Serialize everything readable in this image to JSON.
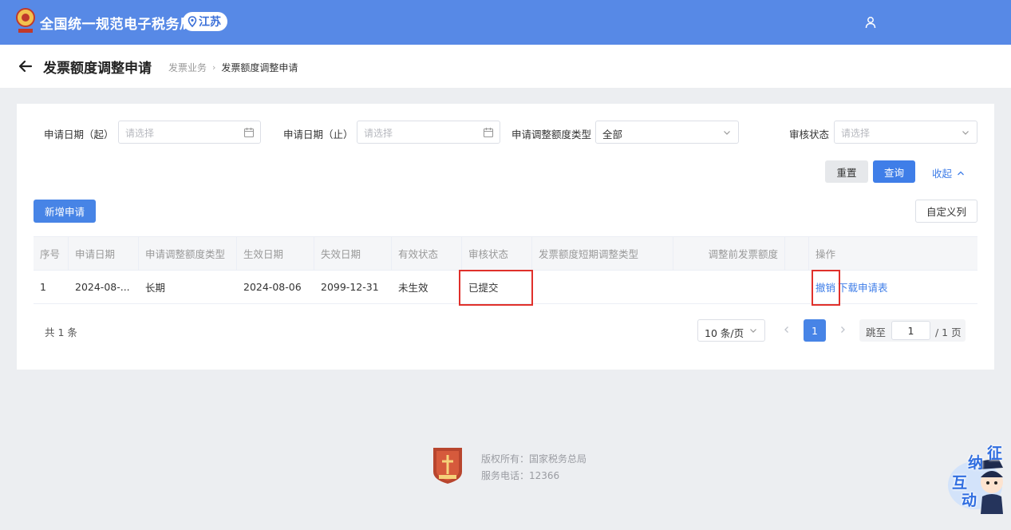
{
  "header": {
    "app_title": "全国统一规范电子税务局",
    "region": "江苏",
    "accent_color": "#5789e6"
  },
  "page": {
    "title": "发票额度调整申请",
    "breadcrumb": [
      "发票业务",
      "发票额度调整申请"
    ]
  },
  "filters": {
    "apply_date_start": {
      "label": "申请日期（起）",
      "placeholder": "请选择"
    },
    "apply_date_end": {
      "label": "申请日期（止）",
      "placeholder": "请选择"
    },
    "adjust_type": {
      "label": "申请调整额度类型",
      "value": "全部"
    },
    "review_status": {
      "label": "审核状态",
      "placeholder": "请选择"
    },
    "reset_label": "重置",
    "query_label": "查询",
    "collapse_label": "收起"
  },
  "toolbar": {
    "new_label": "新增申请",
    "custom_columns_label": "自定义列"
  },
  "table": {
    "columns": [
      "序号",
      "申请日期",
      "申请调整额度类型",
      "生效日期",
      "失效日期",
      "有效状态",
      "审核状态",
      "发票额度短期调整类型",
      "调整前发票额度",
      "",
      "操作"
    ],
    "rows": [
      {
        "index": "1",
        "apply_date": "2024-08-...",
        "adjust_type": "长期",
        "effective_date": "2024-08-06",
        "expiry_date": "2099-12-31",
        "valid_status": "未生效",
        "review_status": "已提交",
        "short_term_type": "",
        "prev_amount": "",
        "actions": [
          "撤销",
          "下载申请表"
        ]
      }
    ]
  },
  "pagination": {
    "total_text": "共 1 条",
    "page_size": "10 条/页",
    "current_page": "1",
    "jump_label": "跳至",
    "jump_value": "1",
    "total_pages_text": "/ 1 页"
  },
  "footer": {
    "copyright": "版权所有：国家税务总局",
    "phone": "服务电话：12366"
  },
  "assistant": {
    "chars": [
      "征",
      "纳",
      "互",
      "动"
    ]
  }
}
